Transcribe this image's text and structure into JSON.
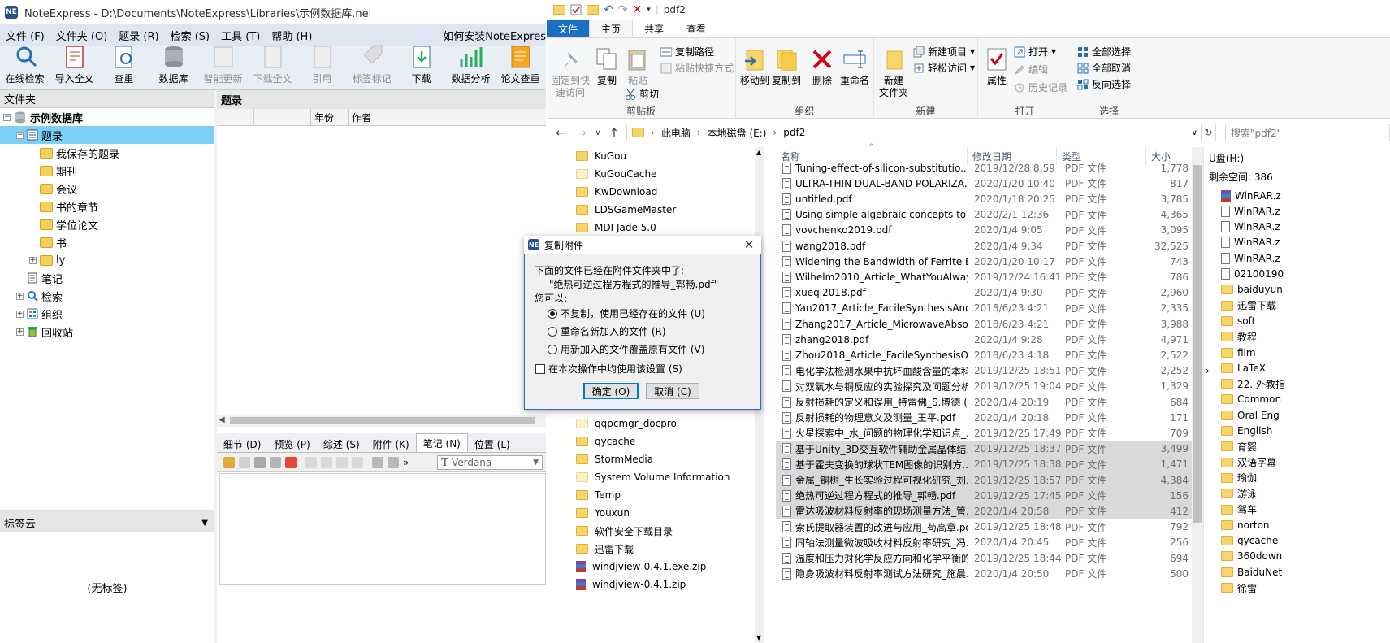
{
  "noteexpress": {
    "title": "NoteExpress - D:\\Documents\\NoteExpress\\Libraries\\示例数据库.nel",
    "menu": [
      "文件 (F)",
      "文件夹 (O)",
      "题录 (R)",
      "检索 (S)",
      "工具 (T)",
      "帮助 (H)"
    ],
    "menu_tip": "如何安装NoteExpres",
    "toolbar": [
      {
        "label": "在线检索",
        "icon": "online-search-icon",
        "enabled": true
      },
      {
        "label": "导入全文",
        "icon": "import-fulltext-icon",
        "enabled": true
      },
      {
        "label": "查重",
        "icon": "duplicate-check-icon",
        "enabled": true
      },
      {
        "label": "数据库",
        "icon": "database-icon",
        "enabled": true
      },
      {
        "label": "智能更新",
        "icon": "smart-update-icon",
        "enabled": false
      },
      {
        "label": "下载全文",
        "icon": "download-fulltext-icon",
        "enabled": false
      },
      {
        "label": "引用",
        "icon": "cite-icon",
        "enabled": false
      },
      {
        "label": "标签标记",
        "icon": "tag-icon",
        "enabled": false
      },
      {
        "label": "下载",
        "icon": "download-icon",
        "enabled": true
      },
      {
        "label": "数据分析",
        "icon": "data-analysis-icon",
        "enabled": true
      },
      {
        "label": "论文查重",
        "icon": "paper-check-icon",
        "enabled": true
      }
    ],
    "folders_header": "文件夹",
    "tree": {
      "root": "示例数据库",
      "records": "题录",
      "record_children": [
        "我保存的题录",
        "期刊",
        "会议",
        "书的章节",
        "学位论文",
        "书",
        "ly"
      ],
      "notes": "笔记",
      "search": "检索",
      "organize": "组织",
      "recycle": "回收站"
    },
    "tag_cloud": {
      "header": "标签云",
      "empty": "(无标签)"
    },
    "records_header": "题录",
    "columns": [
      "",
      "",
      "",
      "年份",
      "作者"
    ],
    "detail_tabs": [
      "细节 (D)",
      "预览 (P)",
      "综述 (S)",
      "附件 (K)",
      "笔记 (N)",
      "位置 (L)"
    ],
    "active_tab": "笔记 (N)",
    "font": "Verdana"
  },
  "explorer": {
    "title": "pdf2",
    "ribbon_tabs": [
      "文件",
      "主页",
      "共享",
      "查看"
    ],
    "active_tab": "主页",
    "groups": {
      "clipboard": {
        "label": "剪贴板",
        "pin": "固定到快\n速访问",
        "copy": "复制",
        "paste": "粘贴",
        "copy_path": "复制路径",
        "paste_shortcut": "粘贴快捷方式",
        "cut": "剪切"
      },
      "organize": {
        "label": "组织",
        "move_to": "移动到",
        "copy_to": "复制到",
        "delete": "删除",
        "rename": "重命名"
      },
      "new": {
        "label": "新建",
        "new_folder": "新建\n文件夹",
        "new_item": "新建项目",
        "easy_access": "轻松访问"
      },
      "open": {
        "label": "打开",
        "properties": "属性",
        "open": "打开",
        "edit": "编辑",
        "history": "历史记录"
      },
      "select": {
        "label": "选择",
        "select_all": "全部选择",
        "select_none": "全部取消",
        "invert": "反向选择"
      }
    },
    "breadcrumb": [
      "此电脑",
      "本地磁盘 (E:)",
      "pdf2"
    ],
    "search_placeholder": "搜索\"pdf2\"",
    "nav_items_top": [
      "KuGou",
      "KuGouCache",
      "KwDownload",
      "LDSGameMaster",
      "MDI Jade 5.0"
    ],
    "nav_items_bottom": [
      "qqpcmgr_docpro",
      "qycache",
      "StormMedia",
      "System Volume Information",
      "Temp",
      "Youxun",
      "软件安全下载目录",
      "迅雷下载",
      "windjview-0.4.1.exe.zip",
      "windjview-0.4.1.zip"
    ],
    "columns": [
      "名称",
      "修改日期",
      "类型",
      "大小"
    ],
    "files": [
      {
        "name": "Tuning-effect-of-silicon-substitutio...",
        "date": "2019/12/28 8:59",
        "type": "PDF 文件",
        "size": "1,778",
        "selected": false
      },
      {
        "name": "ULTRA-THIN DUAL-BAND POLARIZA...",
        "date": "2020/1/20 10:40",
        "type": "PDF 文件",
        "size": "817",
        "selected": false
      },
      {
        "name": "untitled.pdf",
        "date": "2020/1/18 20:25",
        "type": "PDF 文件",
        "size": "3,785",
        "selected": false
      },
      {
        "name": "Using simple algebraic concepts to u...",
        "date": "2020/2/1 12:36",
        "type": "PDF 文件",
        "size": "4,365",
        "selected": false
      },
      {
        "name": "vovchenko2019.pdf",
        "date": "2020/1/4 9:05",
        "type": "PDF 文件",
        "size": "3,095",
        "selected": false
      },
      {
        "name": "wang2018.pdf",
        "date": "2020/1/4 9:34",
        "type": "PDF 文件",
        "size": "32,525",
        "selected": false
      },
      {
        "name": "Widening the Bandwidth of Ferrite El...",
        "date": "2020/1/20 10:17",
        "type": "PDF 文件",
        "size": "743",
        "selected": false
      },
      {
        "name": "Wilhelm2010_Article_WhatYouAlways...",
        "date": "2019/12/24 16:41",
        "type": "PDF 文件",
        "size": "786",
        "selected": false
      },
      {
        "name": "xueqi2018.pdf",
        "date": "2020/1/4 9:30",
        "type": "PDF 文件",
        "size": "2,960",
        "selected": false
      },
      {
        "name": "Yan2017_Article_FacileSynthesisAndEx...",
        "date": "2018/6/23 4:21",
        "type": "PDF 文件",
        "size": "2,335",
        "selected": false
      },
      {
        "name": "Zhang2017_Article_MicrowaveAbsorp...",
        "date": "2018/6/23 4:21",
        "type": "PDF 文件",
        "size": "3,988",
        "selected": false
      },
      {
        "name": "zhang2018.pdf",
        "date": "2020/1/4 9:28",
        "type": "PDF 文件",
        "size": "4,971",
        "selected": false
      },
      {
        "name": "Zhou2018_Article_FacileSynthesisOfTh...",
        "date": "2018/6/23 4:18",
        "type": "PDF 文件",
        "size": "2,522",
        "selected": false
      },
      {
        "name": "电化学法检测水果中抗坏血酸含量的本科...",
        "date": "2019/12/25 18:51",
        "type": "PDF 文件",
        "size": "2,252",
        "selected": false
      },
      {
        "name": "对双氧水与铜反应的实验探究及问题分析...",
        "date": "2019/12/25 19:04",
        "type": "PDF 文件",
        "size": "1,329",
        "selected": false
      },
      {
        "name": "反射损耗的定义和误用_特雷佛_S.博德 (1...",
        "date": "2020/1/4 20:19",
        "type": "PDF 文件",
        "size": "684",
        "selected": false
      },
      {
        "name": "反射损耗的物理意义及测量_王平.pdf",
        "date": "2020/1/4 20:18",
        "type": "PDF 文件",
        "size": "171",
        "selected": false
      },
      {
        "name": "火星探索中_水_问题的物理化学知识点_...",
        "date": "2019/12/25 17:49",
        "type": "PDF 文件",
        "size": "709",
        "selected": false
      },
      {
        "name": "基于Unity_3D交互软件辅助金属晶体结...",
        "date": "2019/12/25 18:37",
        "type": "PDF 文件",
        "size": "3,499",
        "selected": true
      },
      {
        "name": "基于霍夫变换的球状TEM图像的识别方...",
        "date": "2019/12/25 18:38",
        "type": "PDF 文件",
        "size": "1,471",
        "selected": true
      },
      {
        "name": "金属_铜树_生长实验过程可视化研究_刘...",
        "date": "2019/12/25 18:57",
        "type": "PDF 文件",
        "size": "4,384",
        "selected": true
      },
      {
        "name": "绝热可逆过程方程式的推导_郭畅.pdf",
        "date": "2019/12/25 17:45",
        "type": "PDF 文件",
        "size": "156",
        "selected": true
      },
      {
        "name": "雷达吸波材料反射率的现场测量方法_管...",
        "date": "2020/1/4 20:58",
        "type": "PDF 文件",
        "size": "412",
        "selected": true
      },
      {
        "name": "索氏提取器装置的改进与应用_苟高章.pdf",
        "date": "2019/12/25 18:48",
        "type": "PDF 文件",
        "size": "792",
        "selected": false
      },
      {
        "name": "同轴法测量微波吸收材料反射率研究_冯...",
        "date": "2020/1/4 20:45",
        "type": "PDF 文件",
        "size": "256",
        "selected": false
      },
      {
        "name": "温度和压力对化学反应方向和化学平衡的...",
        "date": "2019/12/25 18:44",
        "type": "PDF 文件",
        "size": "694",
        "selected": false
      },
      {
        "name": "隐身吸波材料反射率测试方法研究_施晨...",
        "date": "2020/1/4 20:50",
        "type": "PDF 文件",
        "size": "500",
        "selected": false
      }
    ],
    "preview": {
      "drive": "U盘(H:)",
      "free": "剩余空间: 386",
      "items": [
        {
          "name": "WinRAR.z",
          "kind": "rar"
        },
        {
          "name": "WinRAR.z",
          "kind": "doc"
        },
        {
          "name": "WinRAR.z",
          "kind": "doc"
        },
        {
          "name": "WinRAR.z",
          "kind": "doc"
        },
        {
          "name": "WinRAR.z",
          "kind": "doc"
        },
        {
          "name": "02100190",
          "kind": "doc"
        },
        {
          "name": "baiduyun",
          "kind": "folder"
        },
        {
          "name": "迅雷下载",
          "kind": "folder"
        },
        {
          "name": "soft",
          "kind": "folder"
        },
        {
          "name": "教程",
          "kind": "folder"
        },
        {
          "name": "film",
          "kind": "folder"
        },
        {
          "name": "LaTeX",
          "kind": "folder"
        },
        {
          "name": "22. 外教指",
          "kind": "folder"
        },
        {
          "name": "Common",
          "kind": "folder"
        },
        {
          "name": "Oral Eng",
          "kind": "folder"
        },
        {
          "name": "English",
          "kind": "folder"
        },
        {
          "name": "育婴",
          "kind": "folder"
        },
        {
          "name": "双语字幕",
          "kind": "folder"
        },
        {
          "name": "瑜伽",
          "kind": "folder"
        },
        {
          "name": "游泳",
          "kind": "folder"
        },
        {
          "name": "驾车",
          "kind": "folder"
        },
        {
          "name": "norton",
          "kind": "folder"
        },
        {
          "name": "qycache",
          "kind": "folder"
        },
        {
          "name": "360down",
          "kind": "folder"
        },
        {
          "name": "BaiduNet",
          "kind": "folder"
        },
        {
          "name": "徐雷",
          "kind": "folder"
        }
      ]
    }
  },
  "dialog": {
    "title": "复制附件",
    "line1": "下面的文件已经在附件文件夹中了:",
    "filename": "\"绝热可逆过程方程式的推导_郭畅.pdf\"",
    "line2": "您可以:",
    "options": [
      "不复制，使用已经存在的文件 (U)",
      "重命名新加入的文件 (R)",
      "用新加入的文件覆盖原有文件 (V)"
    ],
    "selected_option": 0,
    "apply_all": "在本次操作中均使用该设置 (S)",
    "ok": "确定 (O)",
    "cancel": "取消 (C)"
  }
}
